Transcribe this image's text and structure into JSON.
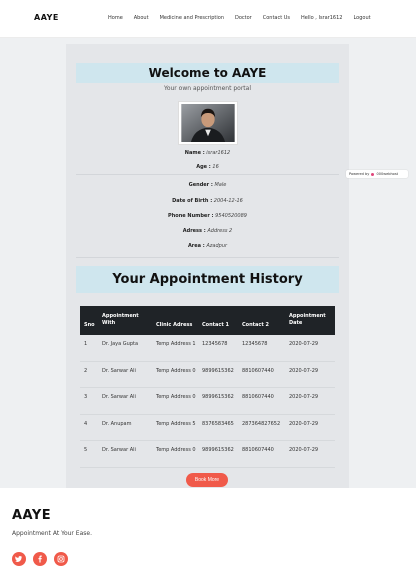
{
  "nav": {
    "brand": "AAYE",
    "links": [
      "Home",
      "About",
      "Medicine and Prescription",
      "Doctor",
      "Contact Us",
      "Hello , Israr1612",
      "Logout"
    ]
  },
  "profile": {
    "welcome": "Welcome to AAYE",
    "subtitle": "Your own appointment portal",
    "fields": [
      {
        "label": "Name :",
        "value": "israr1612"
      },
      {
        "label": "Age :",
        "value": "16"
      },
      {
        "label": "Gender :",
        "value": "Male"
      },
      {
        "label": "Date of Birth :",
        "value": "2004-12-16"
      },
      {
        "label": "Phone Number :",
        "value": "9540520089"
      },
      {
        "label": "Adress :",
        "value": "Address 2"
      },
      {
        "label": "Area :",
        "value": "Azadpur"
      }
    ]
  },
  "history": {
    "title": "Your Appointment History",
    "headers": [
      "Sno",
      "Appointment With",
      "Clinic Adress",
      "Contact 1",
      "Contact 2",
      "Appointment Date"
    ],
    "rows": [
      [
        "1",
        "Dr. Jaya Gupta",
        "Temp Address 1",
        "12345678",
        "12345678",
        "2020-07-29"
      ],
      [
        "2",
        "Dr. Sarwar Ali",
        "Temp Address 0",
        "9899615362",
        "8810607440",
        "2020-07-29"
      ],
      [
        "3",
        "Dr. Sarwar Ali",
        "Temp Address 0",
        "9899615362",
        "8810607440",
        "2020-07-29"
      ],
      [
        "4",
        "Dr. Anupam",
        "Temp Address 5",
        "8376583465",
        "287364827652",
        "2020-07-29"
      ],
      [
        "5",
        "Dr. Sarwar Ali",
        "Temp Address 0",
        "9899615362",
        "8810607440",
        "2020-07-29"
      ]
    ],
    "book_label": "Book More"
  },
  "widget": {
    "text": "Powered by",
    "brand": "000webhost"
  },
  "footer": {
    "brand": "AAYE",
    "tagline": "Appointment At Your Ease.",
    "social": [
      "twitter-icon",
      "facebook-icon",
      "instagram-icon"
    ]
  },
  "colors": {
    "accent": "#f05a4a",
    "banner": "#cfe6ee",
    "table_header": "#1f2327"
  }
}
